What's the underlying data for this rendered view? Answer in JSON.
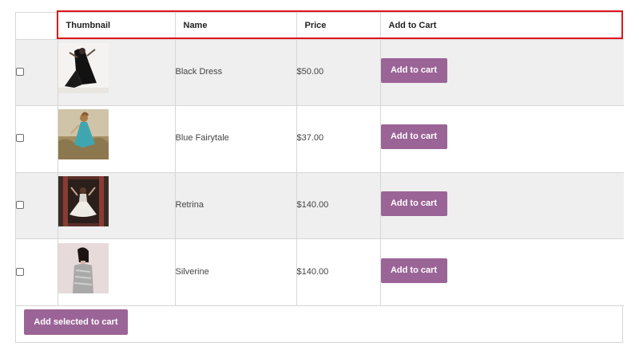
{
  "table": {
    "headers": {
      "check": "",
      "thumbnail": "Thumbnail",
      "name": "Name",
      "price": "Price",
      "cart": "Add to Cart"
    },
    "rows": [
      {
        "name": "Black Dress",
        "price": "$50.00",
        "button": "Add to cart",
        "thumb_icon": "woman-in-black-dress-photo",
        "checked": false
      },
      {
        "name": "Blue Fairytale",
        "price": "$37.00",
        "button": "Add to cart",
        "thumb_icon": "woman-in-blue-dress-field-photo",
        "checked": false
      },
      {
        "name": "Retrina",
        "price": "$140.00",
        "button": "Add to cart",
        "thumb_icon": "woman-in-white-dress-doorway-photo",
        "checked": false
      },
      {
        "name": "Silverine",
        "price": "$140.00",
        "button": "Add to cart",
        "thumb_icon": "woman-in-silver-top-photo",
        "checked": false
      }
    ]
  },
  "footer": {
    "add_selected_label": "Add selected to cart"
  },
  "colors": {
    "button": "#9b6497",
    "row_alt": "#efefef",
    "border": "#d6d6d6",
    "highlight": "#e0141e"
  }
}
